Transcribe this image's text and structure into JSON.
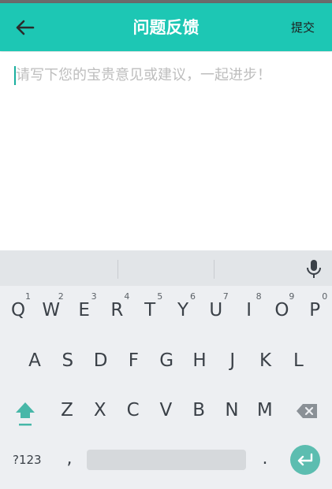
{
  "header": {
    "title": "问题反馈",
    "submit_label": "提交",
    "back_icon": "arrow-left-icon"
  },
  "editor": {
    "placeholder": "请写下您的宝贵意见或建议，一起进步！"
  },
  "keyboard": {
    "row1": [
      {
        "label": "Q",
        "hint": "1"
      },
      {
        "label": "W",
        "hint": "2"
      },
      {
        "label": "E",
        "hint": "3"
      },
      {
        "label": "R",
        "hint": "4"
      },
      {
        "label": "T",
        "hint": "5"
      },
      {
        "label": "Y",
        "hint": "6"
      },
      {
        "label": "U",
        "hint": "7"
      },
      {
        "label": "I",
        "hint": "8"
      },
      {
        "label": "O",
        "hint": "9"
      },
      {
        "label": "P",
        "hint": "0"
      }
    ],
    "row2": [
      "A",
      "S",
      "D",
      "F",
      "G",
      "H",
      "J",
      "K",
      "L"
    ],
    "row3": [
      "Z",
      "X",
      "C",
      "V",
      "B",
      "N",
      "M"
    ],
    "symbols_label": "?123",
    "comma_label": ",",
    "period_label": ".",
    "icons": [
      "microphone-icon",
      "shift-icon",
      "backspace-icon",
      "enter-icon"
    ]
  },
  "colors": {
    "accent": "#1dc7b4",
    "enter": "#5cbdb0"
  }
}
